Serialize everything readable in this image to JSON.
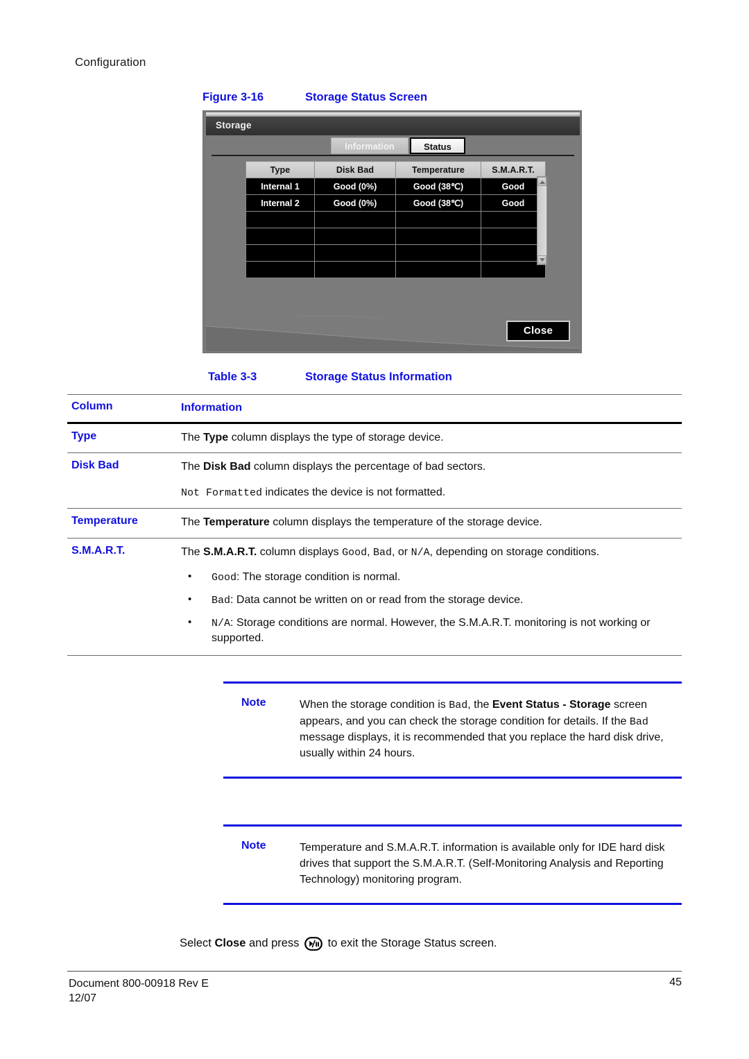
{
  "running_head": "Configuration",
  "figure": {
    "number": "Figure 3-16",
    "title": "Storage Status Screen",
    "dialog": {
      "title": "Storage",
      "tabs": [
        {
          "label": "Information",
          "selected": false
        },
        {
          "label": "Status",
          "selected": true
        }
      ],
      "grid": {
        "headers": [
          "Type",
          "Disk Bad",
          "Temperature",
          "S.M.A.R.T."
        ],
        "rows": [
          [
            "Internal 1",
            "Good (0%)",
            "Good (38℃)",
            "Good"
          ],
          [
            "Internal 2",
            "Good (0%)",
            "Good (38℃)",
            "Good"
          ],
          [
            "",
            "",
            "",
            ""
          ],
          [
            "",
            "",
            "",
            ""
          ],
          [
            "",
            "",
            "",
            ""
          ],
          [
            "",
            "",
            "",
            ""
          ]
        ]
      },
      "close_button": "Close",
      "scrollbar": {
        "up_icon": "triangle-up-icon",
        "down_icon": "triangle-down-icon"
      }
    }
  },
  "table": {
    "number": "Table 3-3",
    "title": "Storage Status Information",
    "headers": {
      "column": "Column",
      "information": "Information"
    },
    "rows": [
      {
        "column": "Type",
        "text_before": "The ",
        "bold": "Type",
        "text_after": " column displays the type of storage device."
      },
      {
        "column": "Disk Bad",
        "text_before": "The ",
        "bold": "Disk Bad",
        "text_after": " column displays the percentage of bad sectors.",
        "second_line_mono": "Not Formatted",
        "second_line_after": " indicates the device is not formatted."
      },
      {
        "column": "Temperature",
        "text_before": "The ",
        "bold": "Temperature",
        "text_after": " column displays the temperature of the storage device."
      },
      {
        "column": "S.M.A.R.T.",
        "text_before": "The ",
        "bold": "S.M.A.R.T.",
        "text_mid_1": " column displays ",
        "mono_1": "Good",
        "text_mid_2": ", ",
        "mono_2": "Bad",
        "text_mid_3": ", or ",
        "mono_3": "N/A",
        "text_after": ", depending on storage conditions.",
        "bullets": [
          {
            "mono": "Good",
            "text": ": The storage condition is normal."
          },
          {
            "mono": "Bad",
            "text": ": Data cannot be written on or read from the storage device."
          },
          {
            "mono": "N/A",
            "text": ": Storage conditions are normal. However, the S.M.A.R.T. monitoring is not working or supported."
          }
        ]
      }
    ]
  },
  "notes": [
    {
      "label": "Note",
      "part1": "When the storage condition is ",
      "mono1": "Bad",
      "part2": ", the ",
      "bold1": "Event Status - Storage",
      "part3": " screen appears, and you can check the storage condition for details. If the ",
      "mono2": "Bad",
      "part4": " message displays, it is recommended that you replace the hard disk drive, usually within 24 hours."
    },
    {
      "label": "Note",
      "part1": "Temperature and S.M.A.R.T. information is available only for IDE hard disk drives that support the S.M.A.R.T. (Self-Monitoring Analysis and Reporting Technology) monitoring program.",
      "mono1": "",
      "part2": "",
      "bold1": "",
      "part3": "",
      "mono2": "",
      "part4": ""
    }
  ],
  "closing": {
    "before": "Select ",
    "bold": "Close",
    "middle": " and press ",
    "icon": "play-pause-key-icon",
    "after": " to exit the Storage Status screen."
  },
  "footer": {
    "document": "Document 800-00918 Rev E",
    "date": "12/07",
    "page": "45"
  },
  "colors": {
    "accent_blue": "#1111dd",
    "dialog_body": "#7b7b7b",
    "dialog_titlebar": "#3a3a3a",
    "grid_row_bg": "#000000"
  }
}
